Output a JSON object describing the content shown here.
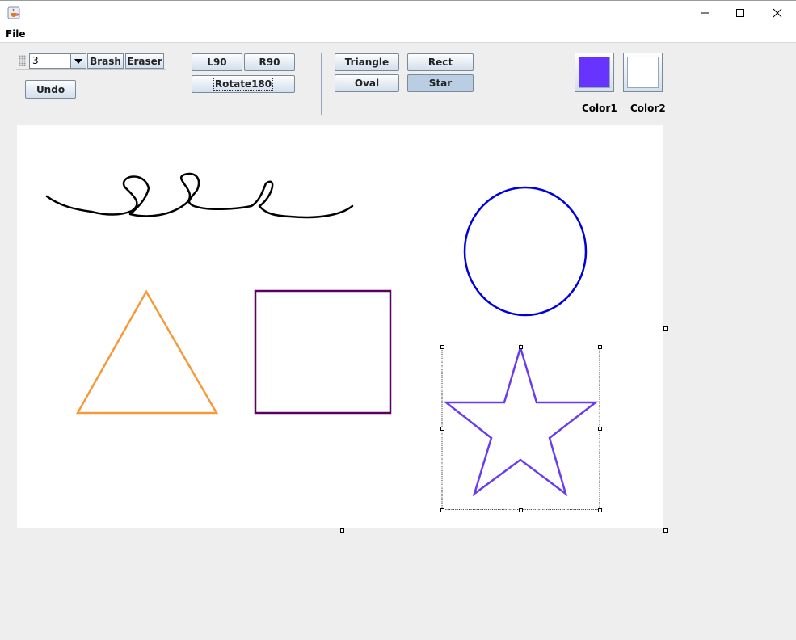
{
  "window": {
    "app_icon": "java-cup-icon",
    "controls": [
      "minimize-icon",
      "maximize-icon",
      "close-icon"
    ]
  },
  "menu": {
    "file_label": "File"
  },
  "toolbar": {
    "stroke_width": "3",
    "brush_label": "Brash",
    "eraser_label": "Eraser",
    "undo_label": "Undo",
    "l90_label": "L90",
    "r90_label": "R90",
    "rotate180_label": "Rotate180",
    "triangle_label": "Triangle",
    "rect_label": "Rect",
    "oval_label": "Oval",
    "star_label": "Star",
    "selected_shape": "Star"
  },
  "colors": {
    "color1_label": "Color1",
    "color2_label": "Color2",
    "color1": "#6633ff",
    "color2": "#ffffff"
  },
  "canvas": {
    "shapes": [
      {
        "type": "freehand",
        "color": "#000000"
      },
      {
        "type": "oval",
        "color": "#0000dd"
      },
      {
        "type": "triangle",
        "color": "#f59a3a"
      },
      {
        "type": "rect",
        "color": "#5a0060"
      },
      {
        "type": "star",
        "color": "#6a3cf0",
        "selected": true
      }
    ]
  }
}
